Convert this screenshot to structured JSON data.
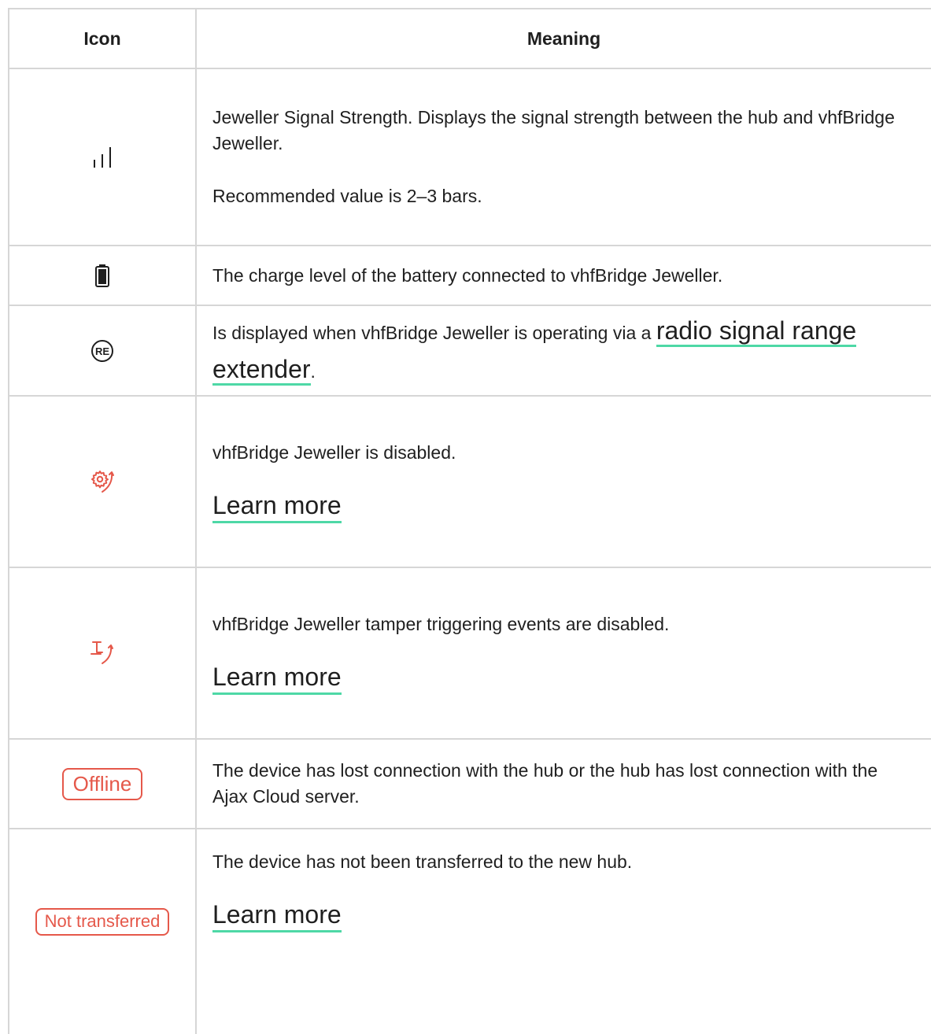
{
  "header": {
    "icon": "Icon",
    "meaning": "Meaning"
  },
  "rows": [
    {
      "icon": "signal-strength-icon",
      "text": "Jeweller Signal Strength. Displays the signal strength between the hub and vhfBridge Jeweller.",
      "note": "Recommended value is 2–3 bars."
    },
    {
      "icon": "battery-icon",
      "text": "The charge level of the battery connected to vhfBridge Jeweller."
    },
    {
      "icon": "range-extender-icon",
      "icon_text": "RE",
      "text": "Is displayed when vhfBridge Jeweller is operating via a ",
      "link": "radio signal range extender",
      "after": "."
    },
    {
      "icon": "device-disabled-icon",
      "text": "vhfBridge Jeweller is disabled.",
      "link": "Learn more"
    },
    {
      "icon": "tamper-disabled-icon",
      "text": "vhfBridge Jeweller tamper triggering events are disabled.",
      "link": "Learn more"
    },
    {
      "badge": "Offline",
      "text": "The device has lost connection with the hub or the hub has lost connection with the Ajax Cloud server."
    },
    {
      "badge": "Not transferred",
      "text": "The device has not been transferred to the new hub.",
      "link": "Learn more"
    }
  ],
  "colors": {
    "accent_link_underline": "#4ed8a6",
    "alert_red": "#e5584a",
    "border": "#d6d6d6"
  }
}
